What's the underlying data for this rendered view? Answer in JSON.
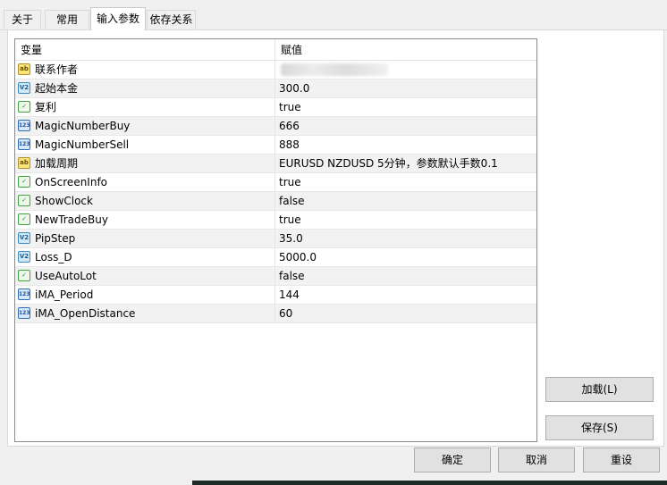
{
  "tabs": [
    {
      "label": "关于",
      "active": false
    },
    {
      "label": "常用",
      "active": false
    },
    {
      "label": "输入参数",
      "active": true
    },
    {
      "label": "依存关系",
      "active": false
    }
  ],
  "grid": {
    "headers": {
      "variable": "变量",
      "value": "赋值"
    },
    "rows": [
      {
        "icon": "string-type-icon",
        "name": "联系作者",
        "value": ""
      },
      {
        "icon": "double-type-icon",
        "name": "起始本金",
        "value": "300.0"
      },
      {
        "icon": "bool-type-icon",
        "name": "复利",
        "value": "true"
      },
      {
        "icon": "int-type-icon",
        "name": "MagicNumberBuy",
        "value": "666"
      },
      {
        "icon": "int-type-icon",
        "name": "MagicNumberSell",
        "value": "888"
      },
      {
        "icon": "string-type-icon",
        "name": "加载周期",
        "value": "EURUSD   NZDUSD   5分钟，参数默认手数0.1"
      },
      {
        "icon": "bool-type-icon",
        "name": "OnScreenInfo",
        "value": "true"
      },
      {
        "icon": "bool-type-icon",
        "name": "ShowClock",
        "value": "false"
      },
      {
        "icon": "bool-type-icon",
        "name": "NewTradeBuy",
        "value": "true"
      },
      {
        "icon": "double-type-icon",
        "name": "PipStep",
        "value": "35.0"
      },
      {
        "icon": "double-type-icon",
        "name": "Loss_D",
        "value": "5000.0"
      },
      {
        "icon": "bool-type-icon",
        "name": "UseAutoLot",
        "value": "false"
      },
      {
        "icon": "int-type-icon",
        "name": "iMA_Period",
        "value": "144"
      },
      {
        "icon": "int-type-icon",
        "name": "iMA_OpenDistance",
        "value": "60"
      }
    ]
  },
  "buttons": {
    "load": "加载(L)",
    "save": "保存(S)",
    "ok": "确定",
    "cancel": "取消",
    "reset": "重设"
  },
  "icon_glyphs": {
    "string": "ab",
    "double": "V2",
    "bool": "✓",
    "int": "123"
  }
}
